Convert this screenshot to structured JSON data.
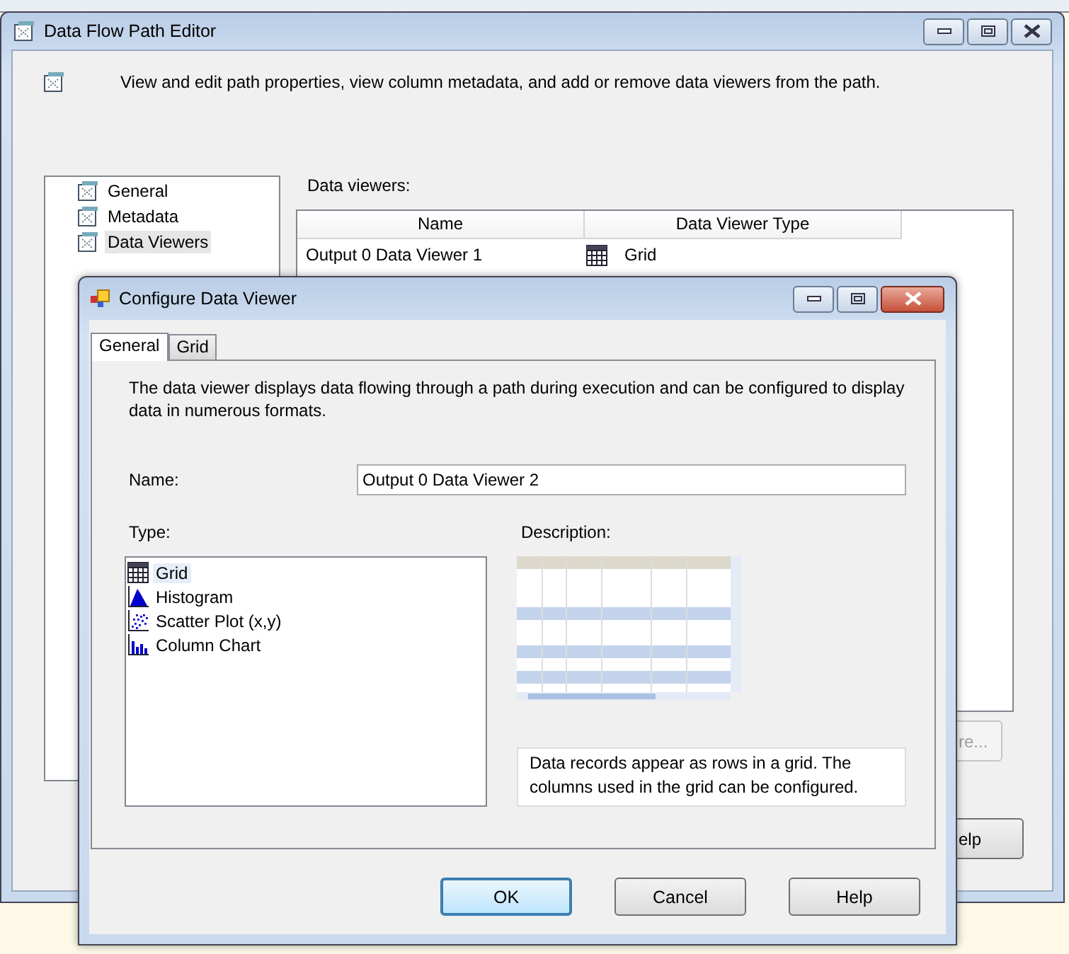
{
  "main_window": {
    "title": "Data Flow Path Editor",
    "description": "View and edit path properties, view column metadata, and add or remove data viewers from the path.",
    "nav_items": [
      {
        "label": "General",
        "selected": false
      },
      {
        "label": "Metadata",
        "selected": false
      },
      {
        "label": "Data Viewers",
        "selected": true
      }
    ],
    "data_viewers_label": "Data viewers:",
    "table": {
      "columns": [
        "Name",
        "Data Viewer Type"
      ],
      "rows": [
        {
          "name": "Output 0 Data Viewer 1",
          "type": "Grid",
          "kind": "grid"
        }
      ]
    },
    "buttons": [
      {
        "label": "re...",
        "disabled": true
      },
      {
        "label": "elp",
        "disabled": false
      }
    ]
  },
  "dialog": {
    "title": "Configure Data Viewer",
    "tabs": [
      {
        "label": "General",
        "selected": true
      },
      {
        "label": "Grid",
        "selected": false
      }
    ],
    "intro": "The data viewer displays data flowing through a path during execution and can be configured to display data in numerous formats.",
    "name_label": "Name:",
    "name_value": "Output 0 Data Viewer 2",
    "type_label": "Type:",
    "types": [
      {
        "label": "Grid",
        "kind": "grid",
        "selected": true
      },
      {
        "label": "Histogram",
        "kind": "histogram",
        "selected": false
      },
      {
        "label": "Scatter Plot (x,y)",
        "kind": "scatter",
        "selected": false
      },
      {
        "label": "Column Chart",
        "kind": "column",
        "selected": false
      }
    ],
    "description_label": "Description:",
    "description": "Data records appear as rows in a grid. The columns used in the grid can be configured.",
    "buttons": [
      {
        "label": "OK",
        "default": true
      },
      {
        "label": "Cancel",
        "default": false
      },
      {
        "label": "Help",
        "default": false
      }
    ]
  }
}
